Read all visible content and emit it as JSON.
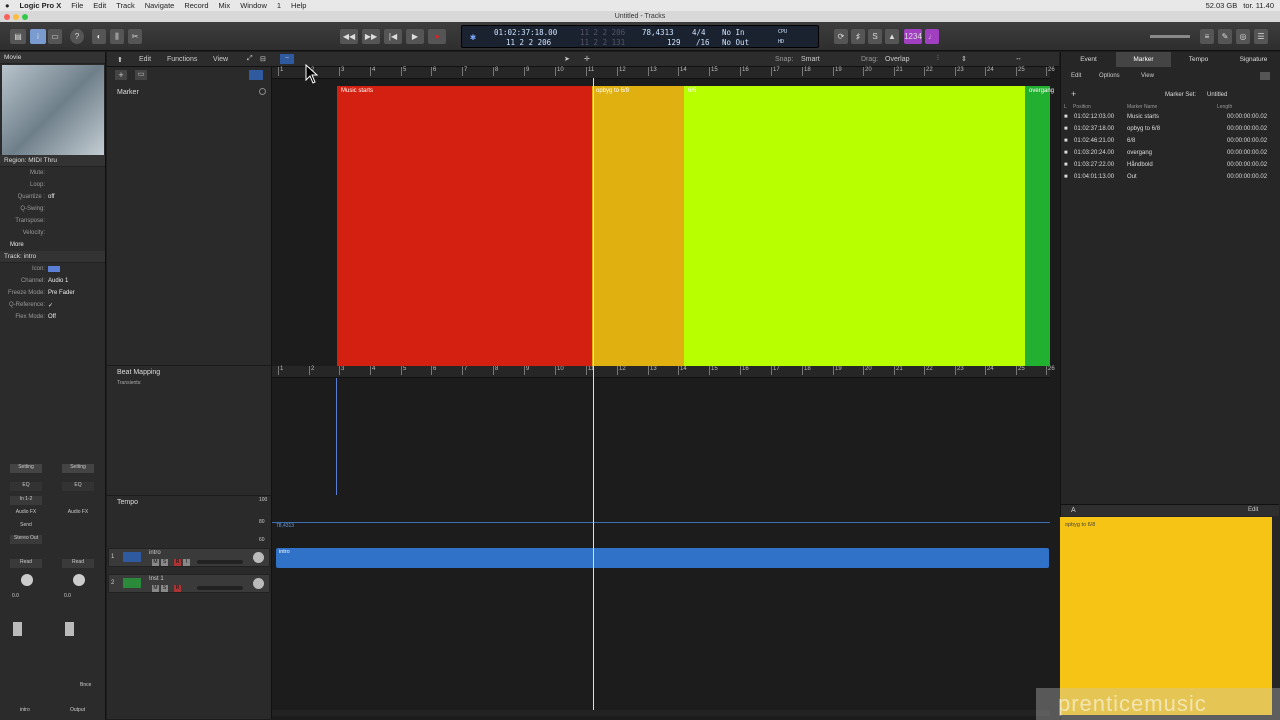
{
  "menubar": {
    "apple": "",
    "app": "Logic Pro X",
    "items": [
      "File",
      "Edit",
      "Track",
      "Navigate",
      "Record",
      "Mix",
      "Window",
      "1",
      "Help"
    ],
    "status": {
      "disk": "52.03 GB",
      "time": "tor. 11.40"
    }
  },
  "window": {
    "title": "Untitled - Tracks"
  },
  "lcd": {
    "smpte": "01:02:37:18.00",
    "bars": "11 2 2 206",
    "smpte_dim": "11 2 2 206",
    "bars_dim": "11 2 2 131",
    "tempo": "78,4313",
    "sig": "4/4",
    "div": "/16",
    "in": "No In",
    "out": "No Out",
    "cpu": "CPU",
    "hd": "HD"
  },
  "transport": {
    "rew": "◀◀",
    "ff": "▶▶",
    "start": "|◀",
    "play": "▶",
    "record": "●"
  },
  "tracks_area": {
    "edit": "Edit",
    "functions": "Functions",
    "view": "View",
    "snap_label": "Snap:",
    "snap": "Smart",
    "drag_label": "Drag:",
    "drag": "Overlap"
  },
  "inspector": {
    "movie": "Movie",
    "region_header": "Region: MIDI Thru",
    "region_props": [
      [
        "Mute:",
        ""
      ],
      [
        "Loop:",
        ""
      ],
      [
        "Quantize :",
        "off"
      ],
      [
        "Q-Swing:",
        ""
      ],
      [
        "Transpose:",
        ""
      ],
      [
        "Velocity:",
        ""
      ]
    ],
    "more": "More",
    "track_header": "Track: intro",
    "track_props": [
      [
        "Icon:",
        ""
      ],
      [
        "Channel:",
        "Audio 1"
      ],
      [
        "Freeze Mode:",
        "Pre Fader"
      ],
      [
        "Q-Reference:",
        "✓"
      ],
      [
        "Flex Mode:",
        "Off"
      ]
    ],
    "strip1": {
      "setting": "Setting",
      "eq": "EQ",
      "input": "In 1-2",
      "fx": "Audio FX",
      "send": "Send",
      "out": "Stereo Out",
      "mode": "Read",
      "vol": "0.0",
      "name": "intro"
    },
    "strip2": {
      "setting": "Setting",
      "eq": "EQ",
      "fx": "Audio FX",
      "mode": "Read",
      "vol": "0.0",
      "bnce": "Bnce",
      "name": "Output"
    }
  },
  "global_tracks": {
    "marker": "Marker",
    "beat": "Beat Mapping",
    "transients": "Transients:",
    "tempo": "Tempo",
    "tempo_vals": [
      "100",
      "80",
      "60"
    ],
    "tempo_line": "78,4313"
  },
  "ruler_ticks": [
    "1",
    "2",
    "3",
    "4",
    "5",
    "6",
    "7",
    "8",
    "9",
    "10",
    "11",
    "12",
    "13",
    "14",
    "15",
    "16",
    "17",
    "18",
    "19",
    "20",
    "21",
    "22",
    "23",
    "24",
    "25",
    "26"
  ],
  "markers": [
    {
      "name": "Music starts",
      "color": "#d42010"
    },
    {
      "name": "opbyg to 6/8",
      "color": "#e0b010"
    },
    {
      "name": "6/8",
      "color": "#b8ff00"
    },
    {
      "name": "overgang",
      "color": "#22b030"
    }
  ],
  "tracks": [
    {
      "num": "1",
      "name": "intro",
      "buttons": [
        "M",
        "S",
        "R",
        "I"
      ]
    },
    {
      "num": "2",
      "name": "Inst 1",
      "buttons": [
        "M",
        "S",
        "R"
      ]
    }
  ],
  "region": {
    "name": "intro"
  },
  "right_panel": {
    "tabs": [
      "Event",
      "Marker",
      "Tempo",
      "Signature"
    ],
    "edit": "Edit",
    "options": "Options",
    "view": "View",
    "marker_set_label": "Marker Set:",
    "marker_set": "Untitled",
    "cols": [
      "L",
      "Position",
      "Marker Name",
      "Length"
    ],
    "rows": [
      [
        "01:02:12:03.00",
        "Music starts",
        "00:00:00:00.02"
      ],
      [
        "01:02:37:18.00",
        "opbyg to 6/8",
        "00:00:00:00.02"
      ],
      [
        "01:02:46:21.00",
        "6/8",
        "00:00:00:00.02"
      ],
      [
        "01:03:20:24.00",
        "overgang",
        "00:00:00:00.02"
      ],
      [
        "01:03:27:22.00",
        "Håndbold",
        "00:00:00:00.02"
      ],
      [
        "01:04:01:13.00",
        "Out",
        "00:00:00:00.02"
      ]
    ],
    "note_edit": "Edit",
    "note_text": "opbyg to 6/8"
  },
  "watermark": "prenticemusic"
}
